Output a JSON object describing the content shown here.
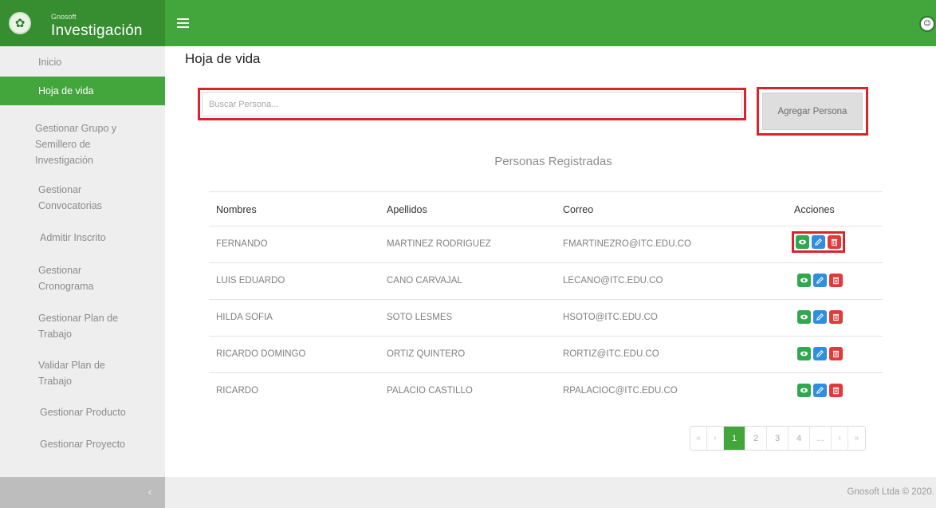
{
  "app": {
    "brand_small": "Gnosoft",
    "brand_title": "Investigación"
  },
  "page": {
    "title": "Hoja de vida",
    "section_title": "Personas Registradas"
  },
  "sidebar": {
    "items": [
      {
        "label": "Inicio"
      },
      {
        "label": "Hoja de vida"
      },
      {
        "label": "Gestionar Grupo y Semillero de Investigación"
      },
      {
        "label": "Gestionar Convocatorias"
      },
      {
        "label": "Admitir Inscrito"
      },
      {
        "label": "Gestionar Cronograma"
      },
      {
        "label": "Gestionar Plan de Trabajo"
      },
      {
        "label": "Validar Plan de Trabajo"
      },
      {
        "label": "Gestionar Producto"
      },
      {
        "label": "Gestionar Proyecto"
      }
    ],
    "active_index": 1,
    "collapse_glyph": "‹"
  },
  "search": {
    "placeholder": "Buscar Persona...",
    "value": ""
  },
  "add_button": {
    "label": "Agregar Persona"
  },
  "table": {
    "headers": [
      "Nombres",
      "Apellidos",
      "Correo",
      "Acciones"
    ],
    "rows": [
      {
        "nombres": "FERNANDO",
        "apellidos": "MARTINEZ RODRIGUEZ",
        "correo": "FMARTINEZRO@ITC.EDU.CO"
      },
      {
        "nombres": "LUIS EDUARDO",
        "apellidos": "CANO CARVAJAL",
        "correo": "LECANO@ITC.EDU.CO"
      },
      {
        "nombres": "HILDA SOFIA",
        "apellidos": "SOTO LESMES",
        "correo": "HSOTO@ITC.EDU.CO"
      },
      {
        "nombres": "RICARDO DOMINGO",
        "apellidos": "ORTIZ QUINTERO",
        "correo": "RORTIZ@ITC.EDU.CO"
      },
      {
        "nombres": "RICARDO",
        "apellidos": "PALACIO CASTILLO",
        "correo": "RPALACIOC@ITC.EDU.CO"
      }
    ],
    "action_icons": [
      "eye-icon",
      "pencil-icon",
      "trash-icon"
    ],
    "action_colors": {
      "view": "#2fa84f",
      "edit": "#2f8ee0",
      "delete": "#e23a3a"
    }
  },
  "pagination": {
    "first": "«",
    "prev": "‹",
    "pages": [
      "1",
      "2",
      "3",
      "4",
      "..."
    ],
    "current": "1",
    "next": "›",
    "last": "»"
  },
  "footer": {
    "text": "Gnosoft Ltda © 2020."
  },
  "colors": {
    "primary_green": "#43a63d",
    "highlight_red": "#d9242b"
  }
}
